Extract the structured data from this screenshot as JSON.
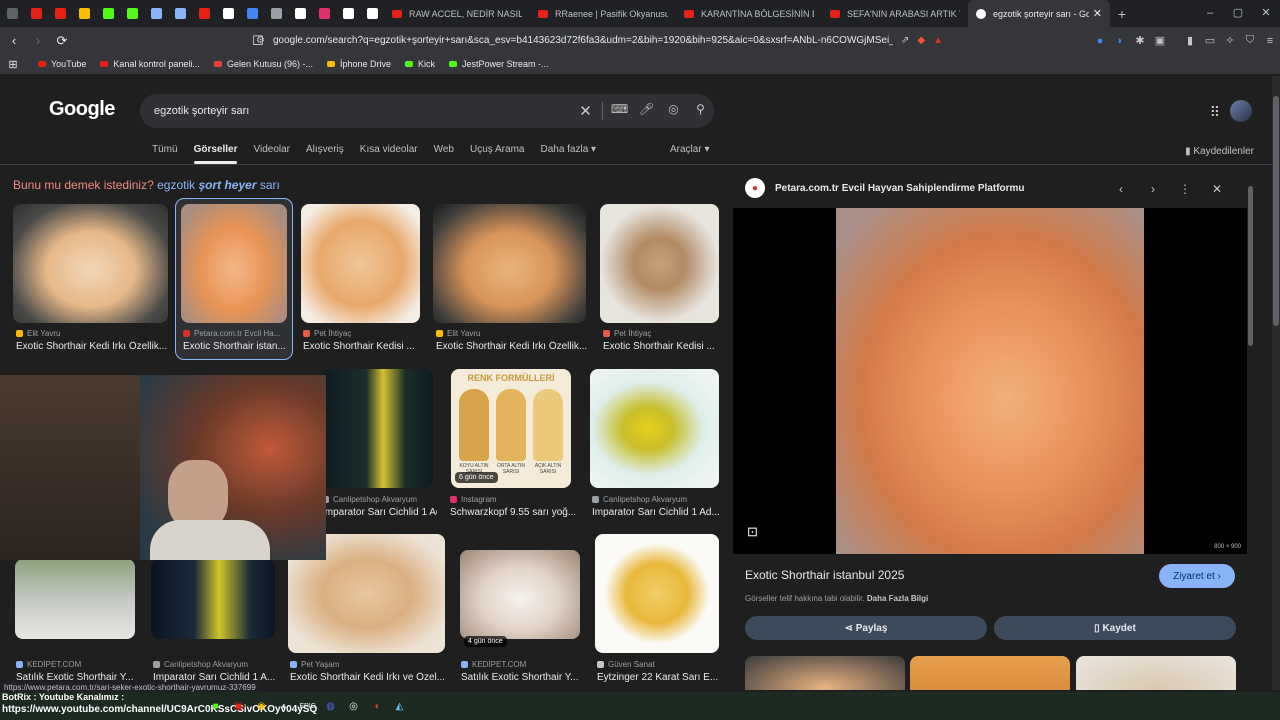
{
  "browser": {
    "pinned_tabs": [
      {
        "color": "#5f6368"
      },
      {
        "color": "#e62117"
      },
      {
        "color": "#e62117"
      },
      {
        "color": "#fbbc04"
      },
      {
        "color": "#53fc18"
      },
      {
        "color": "#53fc18"
      },
      {
        "color": "#8ab4f8"
      },
      {
        "color": "#8ab4f8"
      },
      {
        "color": "#e62117"
      },
      {
        "color": "#ffffff"
      },
      {
        "color": "#4285f4"
      },
      {
        "color": "#9aa0a6"
      },
      {
        "color": "#ffffff"
      },
      {
        "color": "#e1306c"
      },
      {
        "color": "#ffffff"
      },
      {
        "color": "#ffffff"
      }
    ],
    "tabs": [
      {
        "title": "RAW ACCEL, NEDİR NASIL KUR..."
      },
      {
        "title": "RRaenee | Pasifik Okyanusunda..."
      },
      {
        "title": "KARANTİNA BÖLGESİNİN BAŞIN..."
      },
      {
        "title": "SEFA'NIN ARABASI ARTIK YOK |..."
      }
    ],
    "active_tab": {
      "title": "egzotik şorteyir sarı - Goog",
      "close": "✕"
    },
    "new_tab": "+",
    "window_controls": [
      "–",
      "▢",
      "✕"
    ],
    "url": "google.com/search?q=egzotik+şorteyir+sarı&sca_esv=b4143623d72f6fa3&udm=2&bih=1920&bih=925&aic=0&sxsrf=ANbL-n6COWGjMSei_ajWyG...",
    "bookmarks": [
      {
        "label": "YouTube",
        "color": "#e62117"
      },
      {
        "label": "Kanal kontrol paneli...",
        "color": "#e62117"
      },
      {
        "label": "Gelen Kutusu (96) -...",
        "color": "#ea4335"
      },
      {
        "label": "İphone Drive",
        "color": "#fbbc04"
      },
      {
        "label": "Kick",
        "color": "#53fc18"
      },
      {
        "label": "JestPower Stream -...",
        "color": "#53fc18"
      }
    ]
  },
  "google": {
    "logo": "Google",
    "query": "egzotik şorteyir sarı",
    "nav_tabs": [
      "Tümü",
      "Görseller",
      "Videolar",
      "Alışveriş",
      "Kısa videolar",
      "Web",
      "Uçuş Arama",
      "Daha fazla ▾"
    ],
    "active_tab_index": 1,
    "tools": "Araçlar ▾",
    "saved": "Kaydedilenler",
    "did_you_mean": "Bunu mu demek istediniz?",
    "suggestion_pre": "egzotik",
    "suggestion_bold": "şort heyer",
    "suggestion_post": "sarı"
  },
  "results_row1": [
    {
      "source": "Elit Yavru",
      "title": "Exotic Shorthair Kedi Irkı Özellik...",
      "icon_color": "#fbbc04"
    },
    {
      "source": "Petara.com.tr Evcil Ha...",
      "title": "Exotic Shorthair istan...",
      "icon_color": "#d93025"
    },
    {
      "source": "Pet İhtiyaç",
      "title": "Exotic Shorthair Kedisi ...",
      "icon_color": "#e8594a"
    },
    {
      "source": "Elit Yavru",
      "title": "Exotic Shorthair Kedi Irkı Özellik...",
      "icon_color": "#fbbc04"
    },
    {
      "source": "Pet İhtiyaç",
      "title": "Exotic Shorthair Kedisi ...",
      "icon_color": "#e8594a"
    }
  ],
  "results_row2": [
    {
      "source": "Canlipetshop Akvaryum",
      "title": "İmparator Sarı Cichlid 1 Ad...",
      "icon_color": "#9aa0a6"
    },
    {
      "source": "Instagram",
      "title": "Schwarzkopf 9.55 sarı yoğ...",
      "icon_color": "#e1306c",
      "badge": "6 gün önce",
      "poster_title": "RENK FORMÜLLERİ",
      "shades": [
        "KOYU ALTIN SARISI",
        "ORTA ALTIN SARISI",
        "AÇIK ALTIN SARISI"
      ]
    },
    {
      "source": "Canlipetshop Akvaryum",
      "title": "İmparator Sarı Cichlid 1 Ad...",
      "icon_color": "#9aa0a6"
    }
  ],
  "results_row3": [
    {
      "source": "KEDİPET.COM",
      "title": "Satılık Exotic Shorthair Y...",
      "icon_color": "#8ab4f8"
    },
    {
      "source": "Canlipetshop Akvaryum",
      "title": "İmparator Sarı Cichlid 1 A...",
      "icon_color": "#9aa0a6"
    },
    {
      "source": "Pet Yaşam",
      "title": "Exotic Shorthair Kedi Irkı ve Özel...",
      "icon_color": "#8ab4f8"
    },
    {
      "source": "KEDİPET.COM",
      "title": "Satılık Exotic Shorthair Y...",
      "icon_color": "#8ab4f8",
      "badge": "4 gün önce"
    },
    {
      "source": "Güven Sanat",
      "title": "Eytzinger 22 Karat Sarı E...",
      "icon_color": "#c4c7c5"
    }
  ],
  "panel": {
    "site": "Petara.com.tr Evcil Hayvan Sahiplendirme Platformu",
    "dims": "800 × 900",
    "title": "Exotic Shorthair istanbul 2025",
    "visit": "Ziyaret et ›",
    "note": "Görseller telif hakkına tabi olabilir.",
    "more": "Daha Fazla Bilgi",
    "share": "Paylaş",
    "save": "Kaydet"
  },
  "status_url": "https://www.petara.com.tr/sari-seker-exotic-shorthair-yavrumuz-337699",
  "overlay": {
    "chat_line1": "BotRix : Youtube Kanalımız :",
    "chat_line2": "https://www.youtube.com/channel/UC9ArC0KSsCSivOKOyv04ySQ"
  }
}
